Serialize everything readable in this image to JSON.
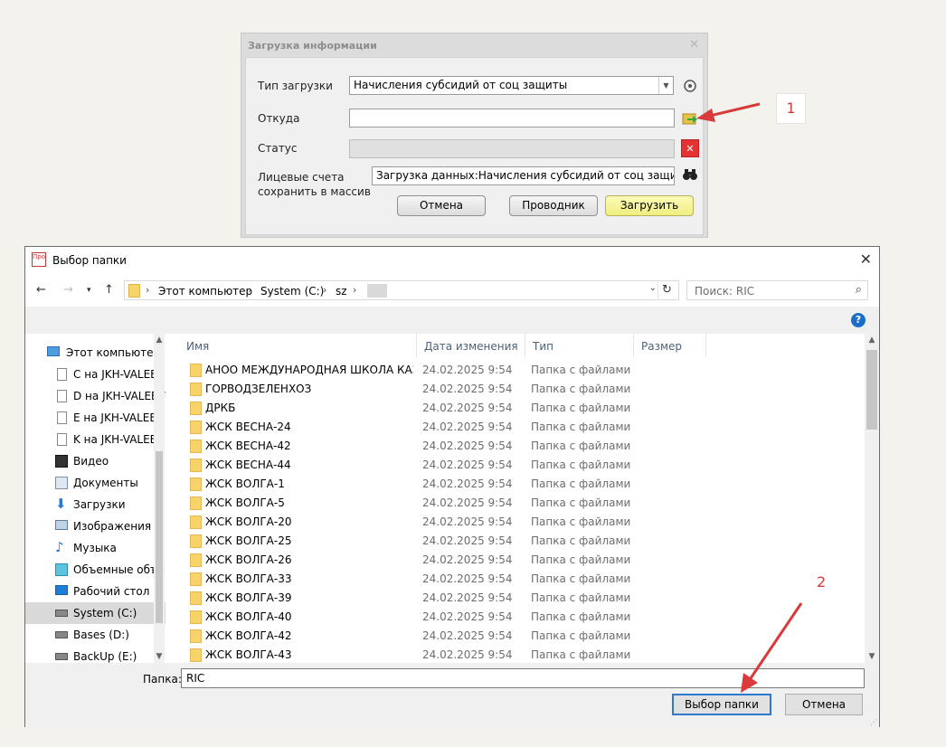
{
  "upload_dialog": {
    "title": "Загрузка информации",
    "close_icon": "close-icon",
    "type_label": "Тип загрузки",
    "type_value": "Начисления субсидий от соц защиты",
    "from_label": "Откуда",
    "from_value": "",
    "status_label": "Статус",
    "status_value": "",
    "accounts_label_line1": "Лицевые счета",
    "accounts_label_line2": "сохранить  в массив",
    "accounts_value": "Загрузка данных:Начисления субсидий от соц защиты",
    "cancel_label": "Отмена",
    "explorer_label": "Проводник",
    "load_label": "Загрузить"
  },
  "annotations": {
    "callout1": "1",
    "callout2": "2",
    "arrow_color": "#d93a3a"
  },
  "picker": {
    "title": "Выбор папки",
    "app_icon_text": "Про",
    "breadcrumbs": [
      "Этот компьютер",
      "System (C:)",
      "sz"
    ],
    "search_placeholder": "Поиск: RIC",
    "nav_items": [
      {
        "label": "Этот компьютер",
        "icon": "computer-icon"
      },
      {
        "label": "C на JKH-VALEEV",
        "icon": "network-drive-icon"
      },
      {
        "label": "D на JKH-VALEEV",
        "icon": "network-drive-icon"
      },
      {
        "label": "E на JKH-VALEEV",
        "icon": "network-drive-icon"
      },
      {
        "label": "K на JKH-VALEEV",
        "icon": "network-drive-icon"
      },
      {
        "label": "Видео",
        "icon": "video-icon"
      },
      {
        "label": "Документы",
        "icon": "documents-icon"
      },
      {
        "label": "Загрузки",
        "icon": "downloads-icon"
      },
      {
        "label": "Изображения",
        "icon": "pictures-icon"
      },
      {
        "label": "Музыка",
        "icon": "music-icon"
      },
      {
        "label": "Объемные объекты",
        "icon": "3d-objects-icon"
      },
      {
        "label": "Рабочий стол",
        "icon": "desktop-icon"
      },
      {
        "label": "System (C:)",
        "icon": "drive-icon"
      },
      {
        "label": "Bases (D:)",
        "icon": "drive-icon"
      },
      {
        "label": "BackUp (E:)",
        "icon": "drive-icon"
      }
    ],
    "columns": {
      "name": "Имя",
      "date": "Дата изменения",
      "type": "Тип",
      "size": "Размер"
    },
    "rows": [
      {
        "name": "АНОО МЕЖДУНАРОДНАЯ ШКОЛА КАЗАНИ",
        "date": "24.02.2025 9:54",
        "type": "Папка с файлами"
      },
      {
        "name": "ГОРВОДЗЕЛЕНХОЗ",
        "date": "24.02.2025 9:54",
        "type": "Папка с файлами"
      },
      {
        "name": "ДРКБ",
        "date": "24.02.2025 9:54",
        "type": "Папка с файлами"
      },
      {
        "name": "ЖСК ВЕСНА-24",
        "date": "24.02.2025 9:54",
        "type": "Папка с файлами"
      },
      {
        "name": "ЖСК ВЕСНА-42",
        "date": "24.02.2025 9:54",
        "type": "Папка с файлами"
      },
      {
        "name": "ЖСК ВЕСНА-44",
        "date": "24.02.2025 9:54",
        "type": "Папка с файлами"
      },
      {
        "name": "ЖСК ВОЛГА-1",
        "date": "24.02.2025 9:54",
        "type": "Папка с файлами"
      },
      {
        "name": "ЖСК ВОЛГА-5",
        "date": "24.02.2025 9:54",
        "type": "Папка с файлами"
      },
      {
        "name": "ЖСК ВОЛГА-20",
        "date": "24.02.2025 9:54",
        "type": "Папка с файлами"
      },
      {
        "name": "ЖСК ВОЛГА-25",
        "date": "24.02.2025 9:54",
        "type": "Папка с файлами"
      },
      {
        "name": "ЖСК ВОЛГА-26",
        "date": "24.02.2025 9:54",
        "type": "Папка с файлами"
      },
      {
        "name": "ЖСК ВОЛГА-33",
        "date": "24.02.2025 9:54",
        "type": "Папка с файлами"
      },
      {
        "name": "ЖСК ВОЛГА-39",
        "date": "24.02.2025 9:54",
        "type": "Папка с файлами"
      },
      {
        "name": "ЖСК ВОЛГА-40",
        "date": "24.02.2025 9:54",
        "type": "Папка с файлами"
      },
      {
        "name": "ЖСК ВОЛГА-42",
        "date": "24.02.2025 9:54",
        "type": "Папка с файлами"
      },
      {
        "name": "ЖСК ВОЛГА-43",
        "date": "24.02.2025 9:54",
        "type": "Папка с файлами"
      }
    ],
    "folder_label": "Папка:",
    "folder_value": "RIC",
    "select_label": "Выбор папки",
    "cancel_label": "Отмена"
  }
}
